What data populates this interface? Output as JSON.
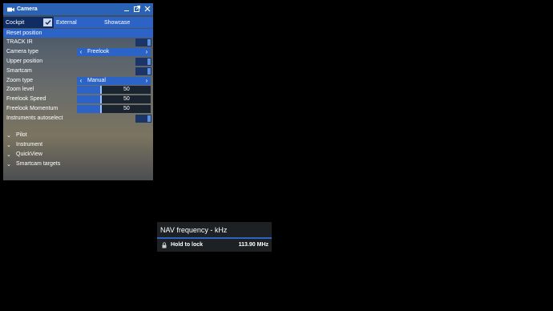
{
  "camera_panel": {
    "title": "Camera",
    "icons": [
      "camera-icon",
      "minimize-icon",
      "popout-icon",
      "close-icon"
    ],
    "tabs": [
      {
        "label": "Cockpit",
        "active": true,
        "checked": true
      },
      {
        "label": "External",
        "active": false
      },
      {
        "label": "Showcase",
        "active": false
      }
    ],
    "reset_label": "Reset position",
    "rows": [
      {
        "type": "toggle",
        "label": "TRACK IR"
      },
      {
        "type": "select",
        "label": "Camera type",
        "value": "Freelook"
      },
      {
        "type": "toggle",
        "label": "Upper position"
      },
      {
        "type": "toggle",
        "label": "Smartcam"
      },
      {
        "type": "select",
        "label": "Zoom type",
        "value": "Manual"
      },
      {
        "type": "slider",
        "label": "Zoom level",
        "value": "50",
        "fraction": 0.33
      },
      {
        "type": "slider",
        "label": "Freelook Speed",
        "value": "50",
        "fraction": 0.33
      },
      {
        "type": "slider",
        "label": "Freelook Momentum",
        "value": "50",
        "fraction": 0.33
      },
      {
        "type": "toggle",
        "label": "Instruments autoselect"
      }
    ],
    "sections": [
      "Pilot",
      "Instrument",
      "QuickView",
      "Smartcam targets"
    ]
  },
  "nav_widget": {
    "title": "NAV frequency - kHz",
    "hold_label": "Hold to lock",
    "frequency": "113.90 MHz",
    "icon": "lock-icon"
  },
  "colors": {
    "accent": "#2b63c6",
    "accent_dark": "#0f2c63",
    "background": "#000000"
  }
}
